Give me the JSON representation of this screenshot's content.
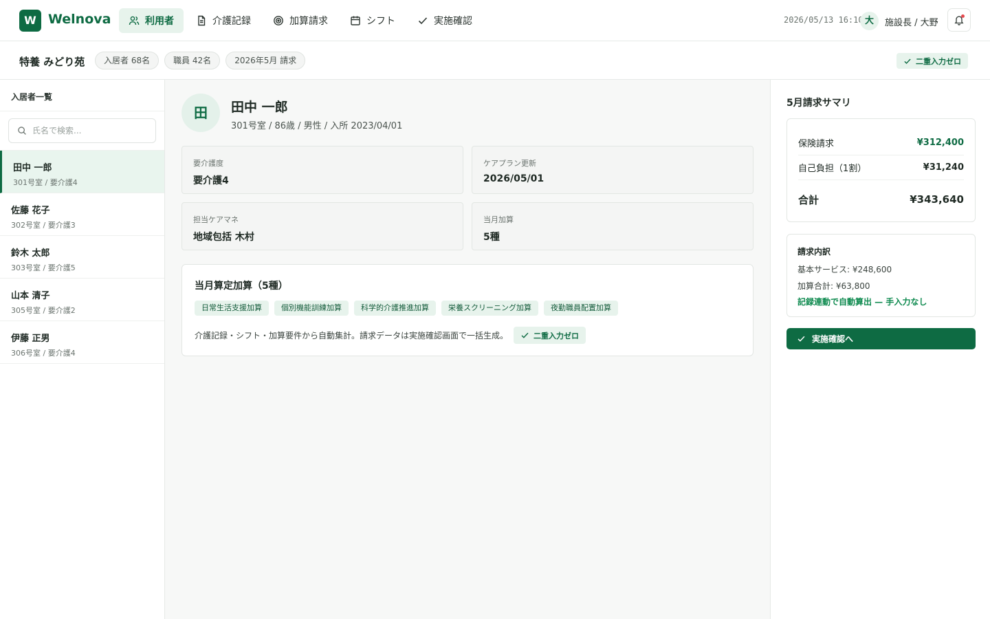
{
  "app": {
    "logo_letter": "W",
    "name": "Welnova"
  },
  "nav": [
    {
      "label": "利用者",
      "icon": "users-icon",
      "active": true
    },
    {
      "label": "介護記録",
      "icon": "document-icon",
      "active": false
    },
    {
      "label": "加算請求",
      "icon": "target-icon",
      "active": false
    },
    {
      "label": "シフト",
      "icon": "calendar-icon",
      "active": false
    },
    {
      "label": "実施確認",
      "icon": "check-icon",
      "active": false
    }
  ],
  "header": {
    "datetime": "2026/05/13 16:10",
    "user_initial": "大",
    "user_name": "施設長 / 大野"
  },
  "facility": {
    "name": "特養 みどり苑",
    "pills": [
      "入居者 68名",
      "職員 42名",
      "2026年5月 請求"
    ],
    "zero_badge": "二重入力ゼロ"
  },
  "sidebar": {
    "title": "入居者一覧",
    "search_placeholder": "氏名で検索...",
    "residents": [
      {
        "name": "田中 一郎",
        "meta": "301号室 / 要介護4"
      },
      {
        "name": "佐藤 花子",
        "meta": "302号室 / 要介護3"
      },
      {
        "name": "鈴木 太郎",
        "meta": "303号室 / 要介護5"
      },
      {
        "name": "山本 清子",
        "meta": "305号室 / 要介護2"
      },
      {
        "name": "伊藤 正男",
        "meta": "306号室 / 要介護4"
      }
    ]
  },
  "profile": {
    "initial": "田",
    "name": "田中 一郎",
    "meta": "301号室 / 86歳 / 男性 / 入所 2023/04/01",
    "cards": [
      {
        "label": "要介護度",
        "value": "要介護4"
      },
      {
        "label": "ケアプラン更新",
        "value": "2026/05/01"
      },
      {
        "label": "担当ケアマネ",
        "value": "地域包括 木村"
      },
      {
        "label": "当月加算",
        "value": "5種"
      }
    ],
    "addons": {
      "title": "当月算定加算（5種）",
      "tags": [
        "日常生活支援加算",
        "個別機能訓練加算",
        "科学的介護推進加算",
        "栄養スクリーニング加算",
        "夜勤職員配置加算"
      ],
      "note": "介護記録・シフト・加算要件から自動集計。請求データは実施確認画面で一括生成。",
      "chip": "二重入力ゼロ"
    }
  },
  "summary": {
    "title": "5月請求サマリ",
    "rows": [
      {
        "label": "保険請求",
        "amount": "¥312,400"
      },
      {
        "label": "自己負担（1割）",
        "amount": "¥31,240"
      }
    ],
    "total_label": "合計",
    "total_amount": "¥343,640",
    "detail": {
      "title": "請求内訳",
      "base": "基本サービス: ¥248,600",
      "addon": "加算合計: ¥63,800",
      "auto": "記録連動で自動算出 — 手入力なし"
    },
    "confirm_label": "実施確認へ"
  },
  "colors": {
    "brand": "#0e6b43",
    "accent_bg": "#e7f3ec",
    "alert_dot": "#e5484d"
  }
}
